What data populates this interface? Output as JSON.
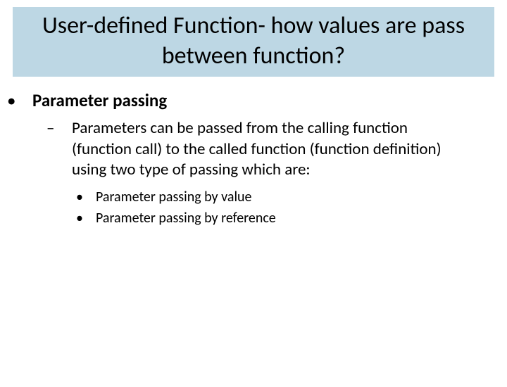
{
  "title": "User-defined Function- how values are pass between function?",
  "level1": {
    "text": "Parameter passing"
  },
  "level2": {
    "text": "Parameters can be passed from the calling function (function call) to the called function (function definition) using two type of passing which are:"
  },
  "level3": [
    {
      "text": "Parameter passing by value"
    },
    {
      "text": "Parameter passing by reference"
    }
  ]
}
